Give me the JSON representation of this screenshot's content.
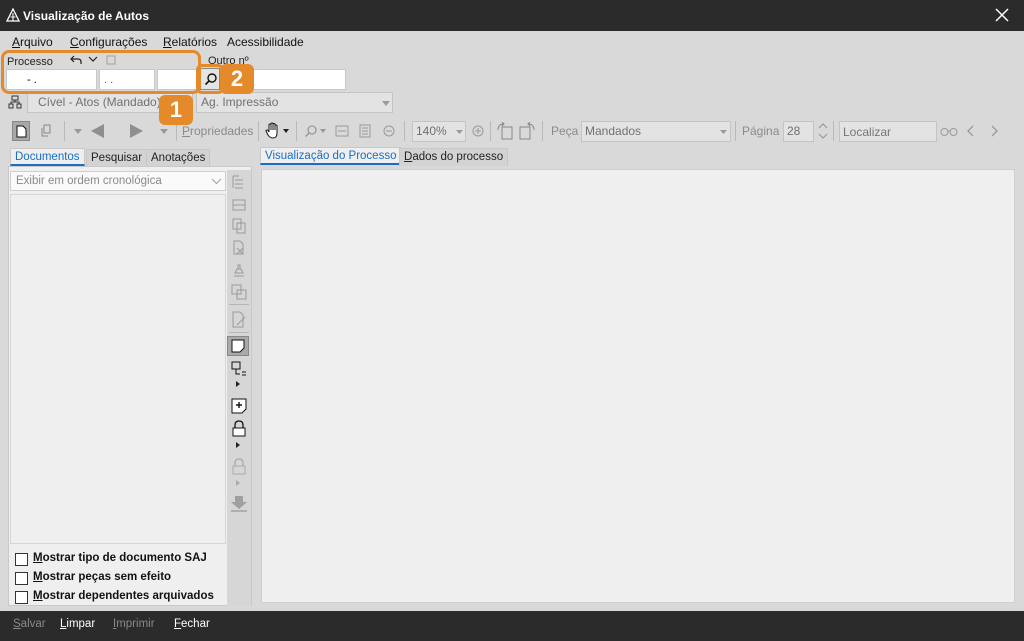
{
  "window": {
    "title": "Visualização de Autos",
    "logo_icon": "court-logo-icon",
    "close_icon": "close-icon"
  },
  "menu": [
    {
      "label": "Arquivo"
    },
    {
      "label": "Configurações"
    },
    {
      "label": "Relatórios"
    },
    {
      "label": "Acessibilidade"
    }
  ],
  "process": {
    "label": "Processo",
    "field1": "- .",
    "field2": ". .",
    "field3": "",
    "other_label": "Outro nº",
    "other_value": "",
    "class_value": "Cível - Atos (Mandado)",
    "status_value": "Ag. Impressão"
  },
  "toolbar": {
    "properties_label": "Propriedades",
    "zoom_value": "140%",
    "piece_label": "Peça",
    "piece_value": "Mandados",
    "page_label": "Página",
    "page_value": "28",
    "find_placeholder": "Localizar"
  },
  "left_tabs": [
    "Documentos",
    "Pesquisar",
    "Anotações"
  ],
  "sort_select": "Exibir em ordem cronológica",
  "checkboxes": [
    "Mostrar tipo de documento SAJ",
    "Mostrar peças sem efeito",
    "Mostrar dependentes arquivados"
  ],
  "right_tabs": [
    "Visualização do Processo",
    "Dados do processo"
  ],
  "statusbar": [
    {
      "label": "Salvar",
      "enabled": false
    },
    {
      "label": "Limpar",
      "enabled": true
    },
    {
      "label": "Imprimir",
      "enabled": false
    },
    {
      "label": "Fechar",
      "enabled": true
    }
  ],
  "callouts": [
    "1",
    "2"
  ],
  "colors": {
    "accent": "#1b6ec2",
    "callout": "#e58a2b",
    "chrome": "#2b2b2b"
  }
}
